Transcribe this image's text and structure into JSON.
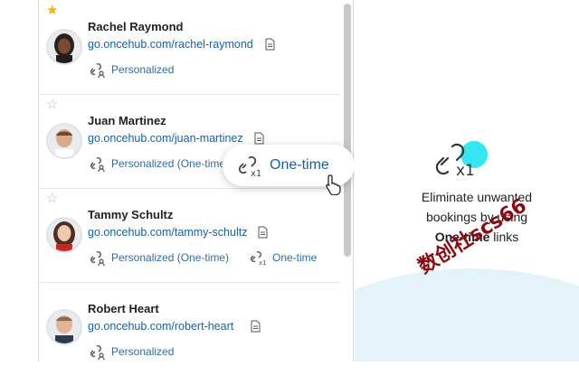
{
  "contacts": [
    {
      "starred": true,
      "name": "Rachel Raymond",
      "link": "go.oncehub.com/rachel-raymond",
      "tags": [
        "Personalized"
      ]
    },
    {
      "starred": false,
      "name": "Juan Martinez",
      "link": "go.oncehub.com/juan-martinez",
      "tags": [
        "Personalized (One-time"
      ]
    },
    {
      "starred": false,
      "name": "Tammy Schultz",
      "link": "go.oncehub.com/tammy-schultz",
      "tags": [
        "Personalized (One-time)",
        "One-time"
      ]
    },
    {
      "starred": false,
      "name": "Robert Heart",
      "link": "go.oncehub.com/robert-heart",
      "tags": [
        "Personalized"
      ]
    }
  ],
  "popup": {
    "label": "One-time"
  },
  "feature": {
    "line1": "Eliminate unwanted",
    "line2": "bookings by using",
    "bold": "One-time",
    "tail": " links",
    "accent": "#33e6f2"
  },
  "watermark": "数创社scs66",
  "colors": {
    "link": "#1a5fa6",
    "star": "#f4b400"
  }
}
